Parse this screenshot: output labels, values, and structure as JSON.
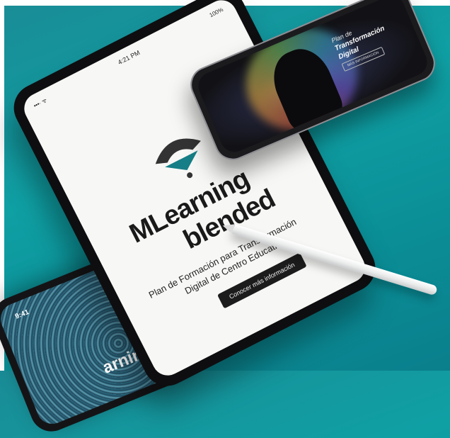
{
  "tablet": {
    "status": {
      "time": "4:21 PM",
      "battery": "100%",
      "signal": "•••∙ ᯤ"
    },
    "brand_line1": "MLearning",
    "brand_line2": "blended",
    "subtitle_line1": "Plan de Formación para Transformación",
    "subtitle_line2": "Digital de Centro Educativo",
    "cta_label": "Conocer más información"
  },
  "phone_top": {
    "line1": "Plan de",
    "line2": "Transformación",
    "line3": "Digital",
    "cta_label": "MÁS INFORMACIÓN"
  },
  "phone_bottom": {
    "time": "9:41",
    "brand_fragment": "arning"
  },
  "colors": {
    "background_teal": "#0fa0a4",
    "logo_teal": "#167e86",
    "logo_dark": "#333333"
  }
}
